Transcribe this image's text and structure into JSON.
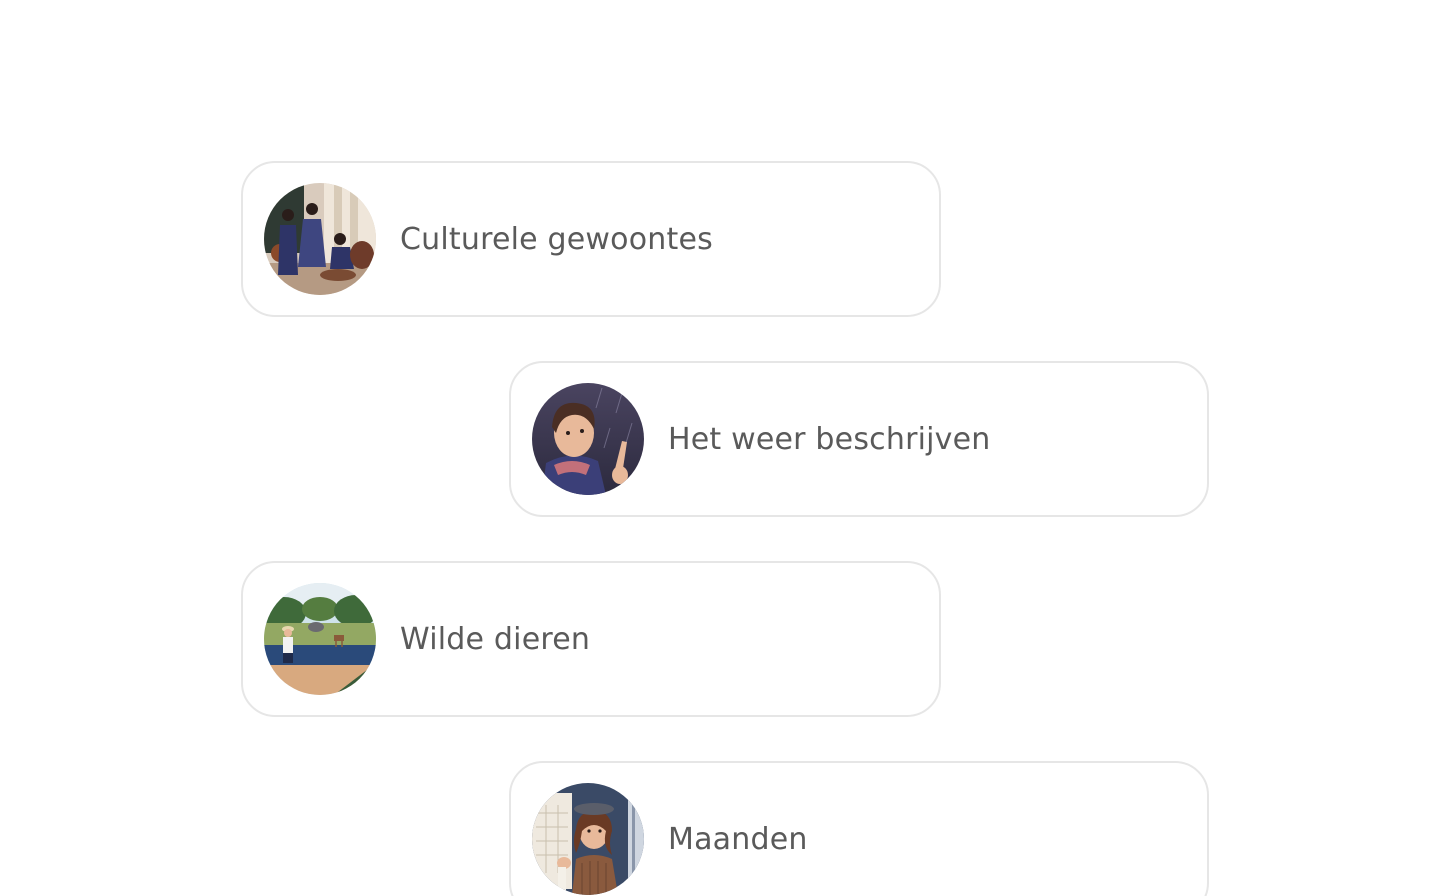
{
  "topics": [
    {
      "label": "Culturele gewoontes",
      "icon": "cultural-customs-illustration"
    },
    {
      "label": "Het weer beschrijven",
      "icon": "weather-boy-illustration"
    },
    {
      "label": "Wilde dieren",
      "icon": "wild-animals-illustration"
    },
    {
      "label": "Maanden",
      "icon": "calendar-woman-illustration"
    }
  ],
  "colors": {
    "card_border": "#e6e6e6",
    "label_text": "#5a5a5a",
    "background": "#ffffff"
  }
}
